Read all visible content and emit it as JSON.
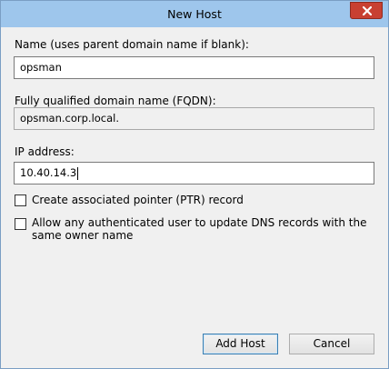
{
  "window": {
    "title": "New Host"
  },
  "form": {
    "name_label": "Name (uses parent domain name if blank):",
    "name_value": "opsman",
    "fqdn_label": "Fully qualified domain name (FQDN):",
    "fqdn_value": "opsman.corp.local.",
    "ip_label": "IP address:",
    "ip_value": "10.40.14.3",
    "ptr_checkbox_label": "Create associated pointer (PTR) record",
    "ptr_checked": false,
    "auth_checkbox_label_line1": "Allow any authenticated user to update DNS records with the",
    "auth_checkbox_label_line2": "same owner name",
    "auth_checked": false
  },
  "buttons": {
    "add_host": "Add Host",
    "cancel": "Cancel"
  },
  "icons": {
    "close": "close-icon"
  },
  "colors": {
    "titlebar": "#9ec6ec",
    "close_button": "#c84031",
    "dialog_background": "#f0f0f0",
    "default_button_border": "#3c7fb1"
  }
}
